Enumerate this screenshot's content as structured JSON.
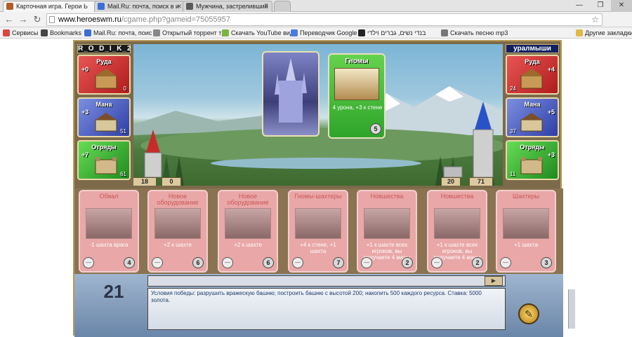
{
  "browser": {
    "tabs": [
      {
        "title": "Карточная игра. Герои Ь",
        "active": true,
        "fav": "#b35b2a"
      },
      {
        "title": "Mail.Ru: почта, поиск в и",
        "active": false,
        "fav": "#3a6fd6"
      },
      {
        "title": "Мужчина, застреливший",
        "active": false,
        "fav": "#5a5a5a"
      }
    ],
    "url_host": "www.heroeswm.ru",
    "url_path": "/cgame.php?gameid=75055957",
    "bookmarks": [
      {
        "label": "Сервисы",
        "color": "#d44"
      },
      {
        "label": "Bookmarks",
        "color": "#444"
      },
      {
        "label": "Mail.Ru: почта, поис",
        "color": "#3a6fd6"
      },
      {
        "label": "Открытый торрент тр",
        "color": "#888"
      },
      {
        "label": "Скачать YouTube вид",
        "color": "#7db53c"
      },
      {
        "label": "Переводчик Google",
        "color": "#4a7be0"
      },
      {
        "label": "בנדי נשים, גברים וילדי",
        "color": "#222"
      },
      {
        "label": "Скачать песню mp3",
        "color": "#777"
      }
    ],
    "other_bookmarks": "Другие закладки"
  },
  "players": {
    "left": {
      "name": "R_O_D_I_K_2",
      "resources": [
        {
          "name": "Руда",
          "prod": "+0",
          "amount": "0"
        },
        {
          "name": "Мана",
          "prod": "+3",
          "amount": "51"
        },
        {
          "name": "Отряды",
          "prod": "+7",
          "amount": "61"
        }
      ],
      "tower": "18",
      "wall": "0"
    },
    "right": {
      "name": "уралмыши",
      "resources": [
        {
          "name": "Руда",
          "prod": "+4",
          "amount": "24"
        },
        {
          "name": "Мана",
          "prod": "+5",
          "amount": "37"
        },
        {
          "name": "Отряды",
          "prod": "+3",
          "amount": "11"
        }
      ],
      "wall": "20",
      "tower": "71"
    }
  },
  "played_card": {
    "title": "Гномы",
    "description": "4 урона, +3 к стене",
    "cost": "5"
  },
  "hand": [
    {
      "title": "Обвал",
      "description": "-1 шахта врага",
      "cost": "4"
    },
    {
      "title": "Новое оборудование",
      "description": "+2 к шахте",
      "cost": "6"
    },
    {
      "title": "Новое оборудование",
      "description": "+2 к шахте",
      "cost": "6"
    },
    {
      "title": "Гномы-шахтеры",
      "description": "+4 к стене, +1 шахта",
      "cost": "7"
    },
    {
      "title": "Новшества",
      "description": "+1 к шахте всех игроков, вы получаете 4 маны",
      "cost": "2"
    },
    {
      "title": "Новшества",
      "description": "+1 к шахте всех игроков, вы получаете 4 маны",
      "cost": "2"
    },
    {
      "title": "Шахтеры",
      "description": "+1 шахта",
      "cost": "3"
    }
  ],
  "turn": "21",
  "log_text": "Условия победы: разрушить вражескую башню; построить башню с высотой 200; накопить 500 каждого ресурса. Ставка: 5000 золота."
}
